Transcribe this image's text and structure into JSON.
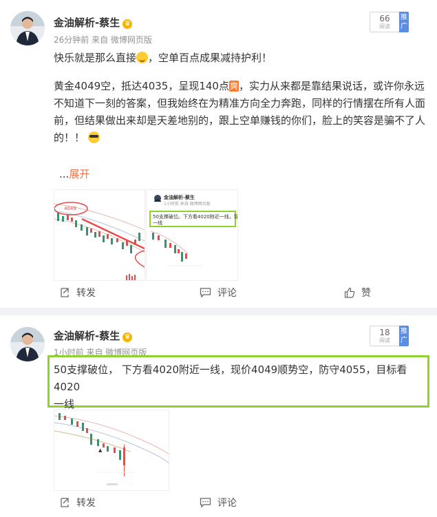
{
  "posts": [
    {
      "username": "金油解析-蔡生",
      "verified_icon": "vip-badge-icon",
      "time": "26分钟前",
      "source": "来自 微博网页版",
      "read_count": "66",
      "read_label": "阅读",
      "push_label": "推广",
      "line1_a": "快乐就是那么直接",
      "line1_b": "，空单百点成果减持护利！",
      "para2_a": "黄金4049空，抵达4035，呈现140点",
      "para2_badge": "爽",
      "para2_b": "，实力从来都是靠结果说话，或许你永远",
      "para2_line2": "不知道下一刻的答案，但我始终在为精准方向全力奔跑，同样的行情摆在所有人面",
      "para2_line3": "前，但结果做出来却是天差地别的，跟上空单赚钱的你们，脸上的笑容是骗不了人",
      "para2_line4": "的！！",
      "expand_prefix": "...",
      "expand_label": "展开",
      "thumb_preview": {
        "username": "金油解析-蔡生",
        "meta": "1小时前 来自 微博网页版",
        "quote": "50支撑破位。下方看4020附近一线，现价4",
        "quote2": "一线"
      },
      "actions": {
        "repost": "转发",
        "comment": "评论",
        "like": "赞"
      }
    },
    {
      "username": "金油解析-蔡生",
      "verified_icon": "vip-badge-icon",
      "time": "1小时前",
      "source": "来自 微博网页版",
      "read_count": "18",
      "read_label": "阅读",
      "push_label": "推广",
      "body_line1": "50支撑破位，  下方看4020附近一线，现价4049顺势空，防守4055，目标看4020",
      "body_line2": "一线",
      "actions": {
        "repost": "转发",
        "comment": "评论"
      }
    }
  ],
  "colors": {
    "highlight": "#8fd12f",
    "link": "#eb7350",
    "push": "#5b8de3",
    "up_candle": "#e94b4b",
    "down_candle": "#2a9a6a"
  }
}
